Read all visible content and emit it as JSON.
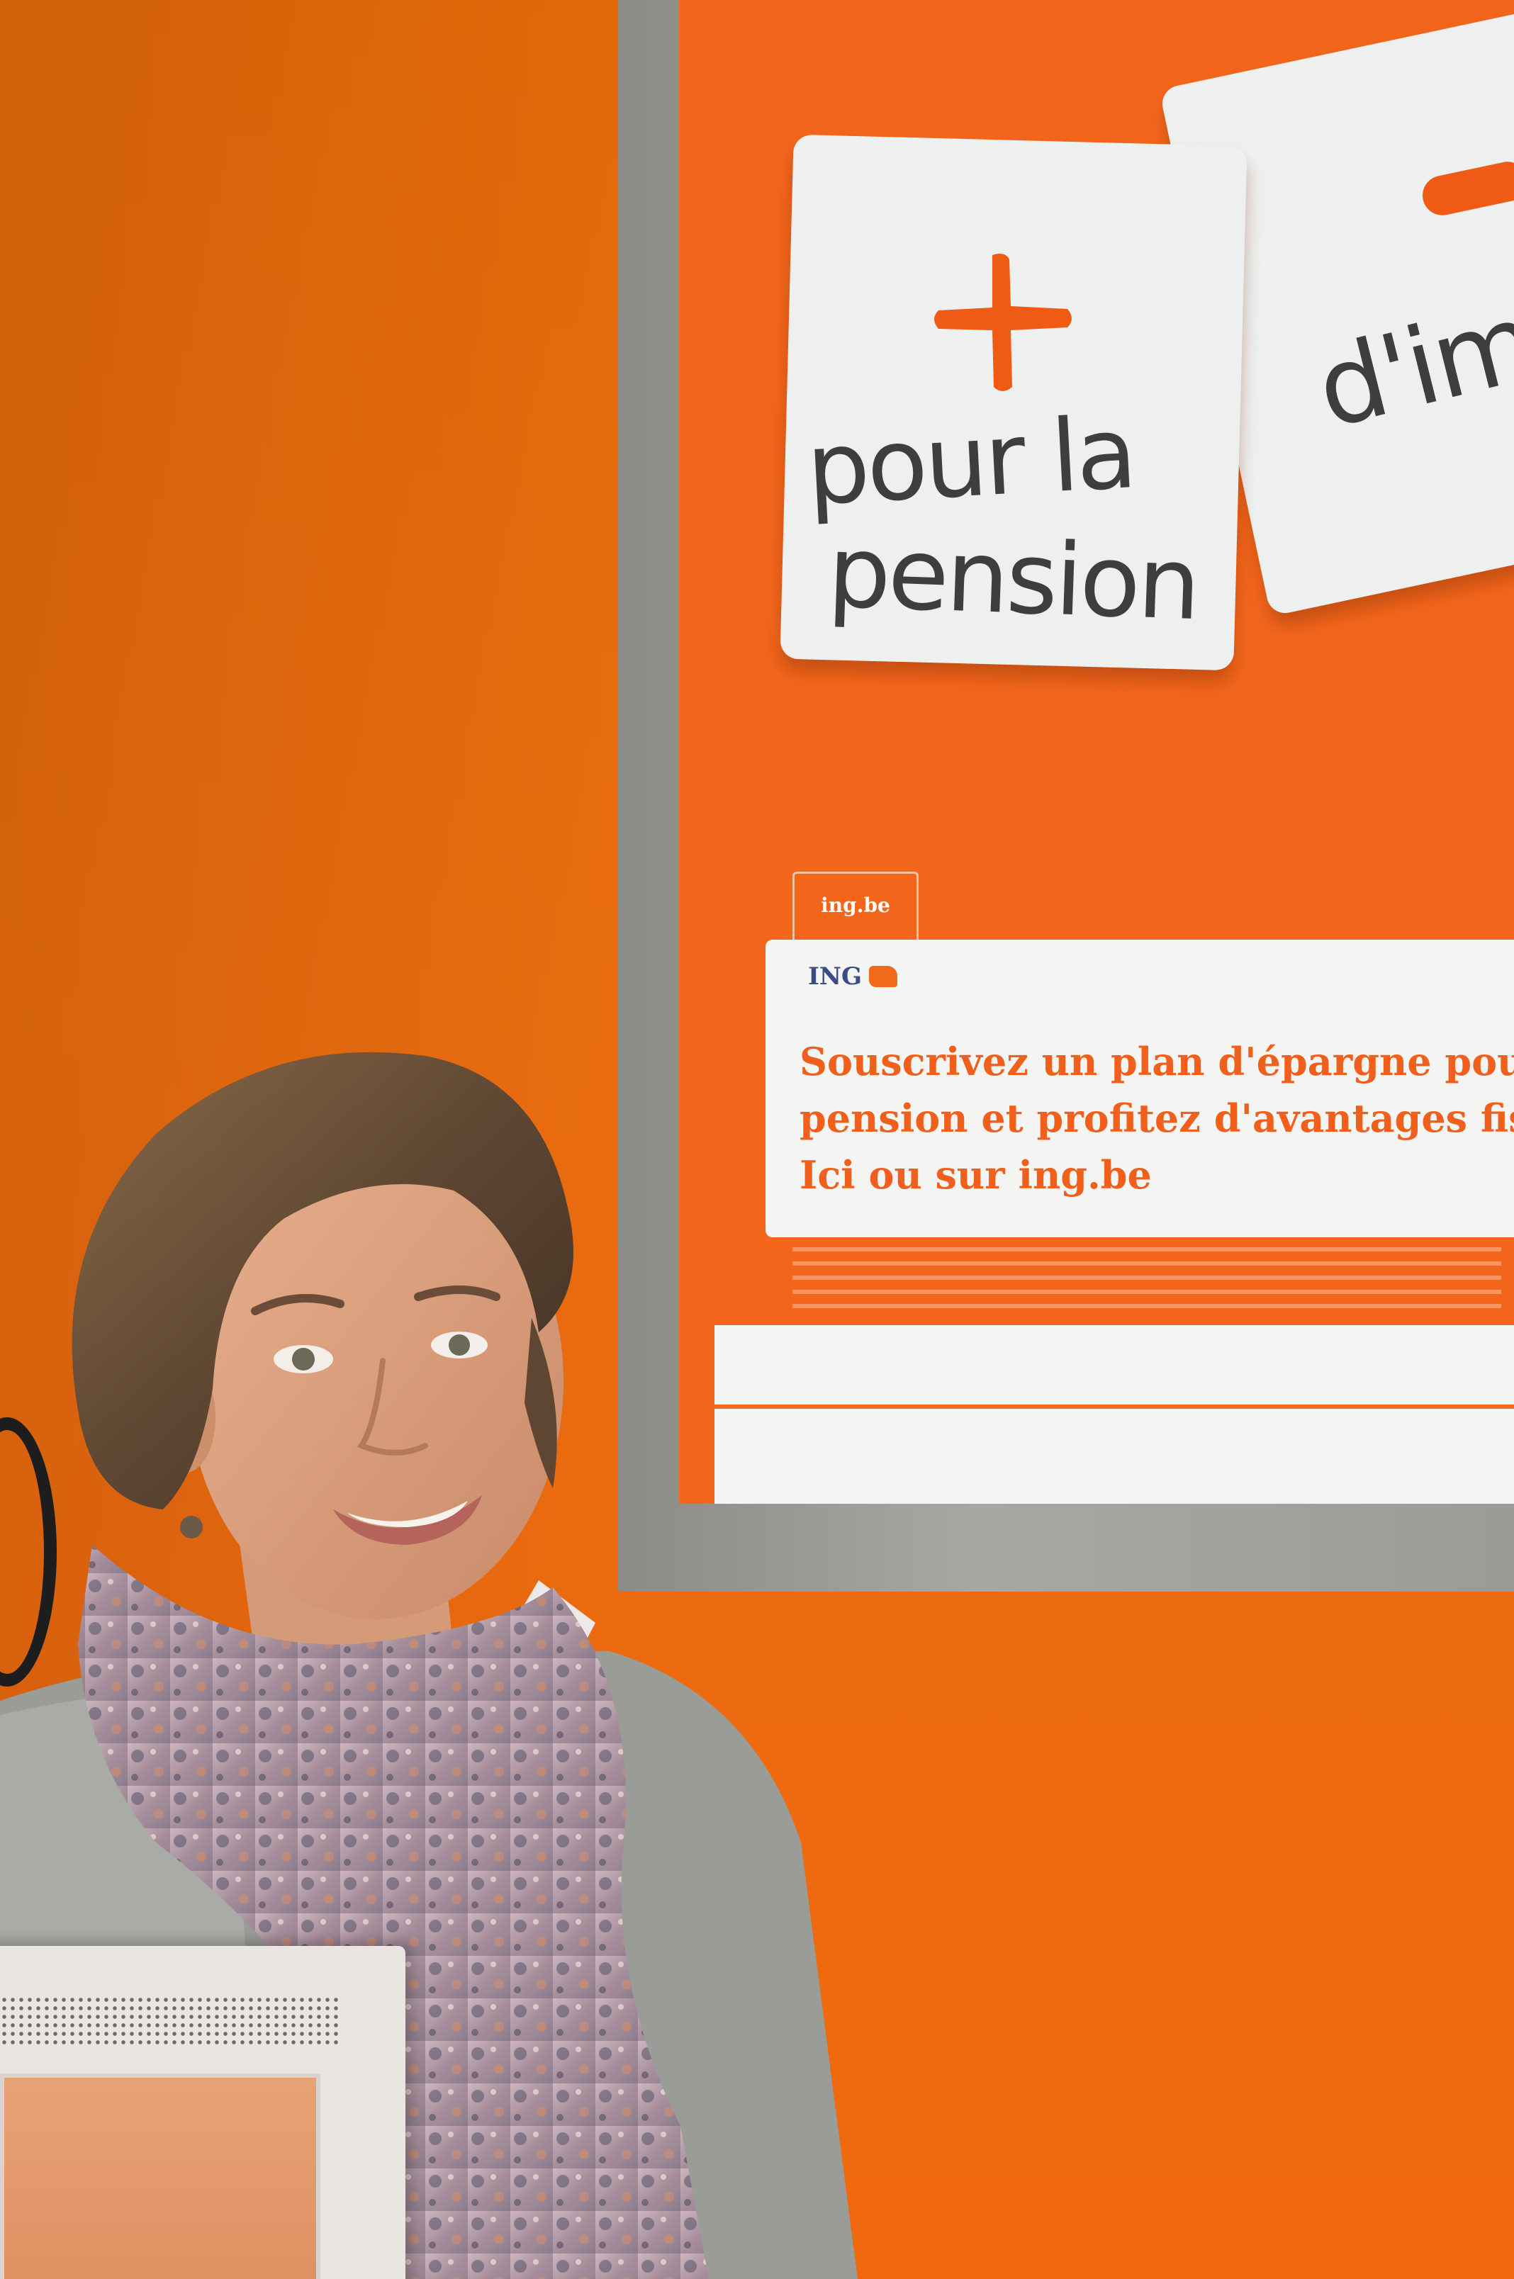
{
  "scene": {
    "description_free": true
  },
  "poster": {
    "note_left_line1": "pour la",
    "note_left_line2": "pension",
    "note_right_text": "d'im",
    "ing_url": "ing.be",
    "ing_logo": "ING",
    "headline_1": "Souscrivez un plan d'épargne pou",
    "headline_2": "pension et profitez d'avantages fis",
    "headline_3": "Ici ou sur ing.be"
  },
  "colors": {
    "wall": "#e86a0e",
    "poster_orange": "#f3661c",
    "note_white": "#eef0f0",
    "headline_orange": "#f0601c",
    "ing_blue": "#3c4a86"
  }
}
